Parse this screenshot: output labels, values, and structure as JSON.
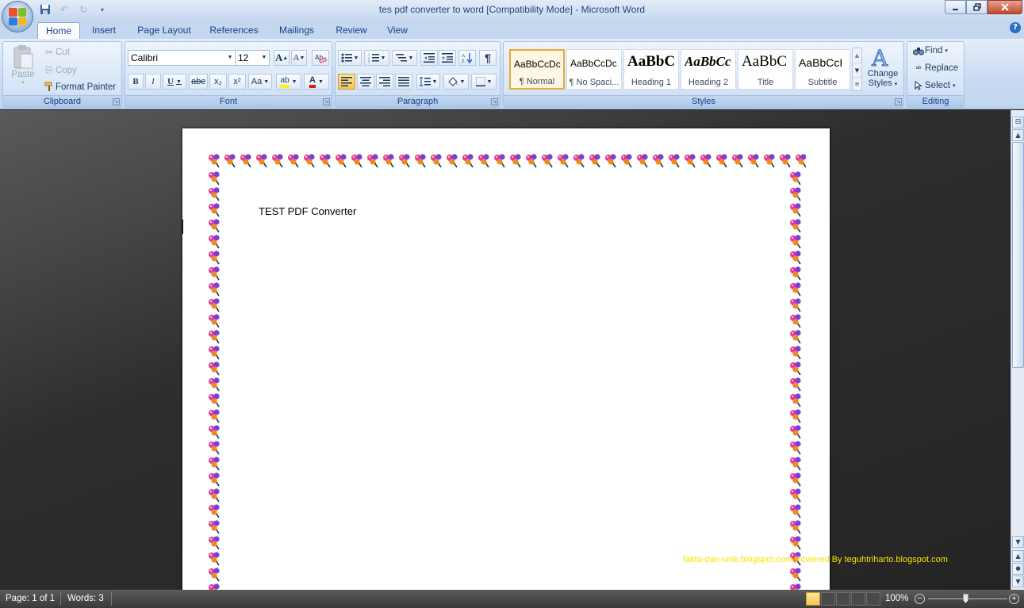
{
  "window": {
    "title": "tes pdf converter to word [Compatibility Mode] - Microsoft Word",
    "controls": [
      "minimize-icon",
      "restore-icon",
      "close-icon"
    ]
  },
  "quick_access": [
    "save-icon",
    "undo-icon",
    "redo-icon",
    "customize-icon"
  ],
  "tabs": [
    {
      "label": "Home",
      "active": true
    },
    {
      "label": "Insert"
    },
    {
      "label": "Page Layout"
    },
    {
      "label": "References"
    },
    {
      "label": "Mailings"
    },
    {
      "label": "Review"
    },
    {
      "label": "View"
    }
  ],
  "ribbon": {
    "clipboard": {
      "label": "Clipboard",
      "paste": "Paste",
      "cut": "Cut",
      "copy": "Copy",
      "format_painter": "Format Painter"
    },
    "font": {
      "label": "Font",
      "family": "Calibri",
      "size": "12",
      "bold": "B",
      "italic": "I",
      "underline": "U",
      "strike": "abc",
      "subscript": "x₂",
      "superscript": "x²",
      "change_case": "Aa",
      "highlight": "ab",
      "font_color": "A",
      "grow": "A",
      "shrink": "A"
    },
    "paragraph": {
      "label": "Paragraph",
      "show_marks": "¶"
    },
    "styles": {
      "label": "Styles",
      "items": [
        {
          "sample": "AaBbCcDc",
          "name": "¶ Normal",
          "selected": true
        },
        {
          "sample": "AaBbCcDc",
          "name": "¶ No Spaci..."
        },
        {
          "sample": "AaBbC",
          "name": "Heading 1"
        },
        {
          "sample": "AaBbCc",
          "name": "Heading 2"
        },
        {
          "sample": "AaBbC",
          "name": "Title"
        },
        {
          "sample": "AaBbCcI",
          "name": "Subtitle"
        }
      ],
      "change_styles": "Change",
      "change_styles_2": "Styles"
    },
    "editing": {
      "label": "Editing",
      "find": "Find",
      "replace": "Replace",
      "select": "Select"
    }
  },
  "document": {
    "text": "TEST PDF Converter"
  },
  "watermark": "fakta-dan-unik.blogspot.com Powered By teguhtriharto.blogspot.com",
  "status": {
    "page": "Page: 1 of 1",
    "words": "Words: 3",
    "zoom": "100%"
  },
  "colors": {
    "accent": "#15428b",
    "ribbon": "#d7e5f7",
    "highlight": "#f6c452",
    "watermark": "#f2e600"
  }
}
